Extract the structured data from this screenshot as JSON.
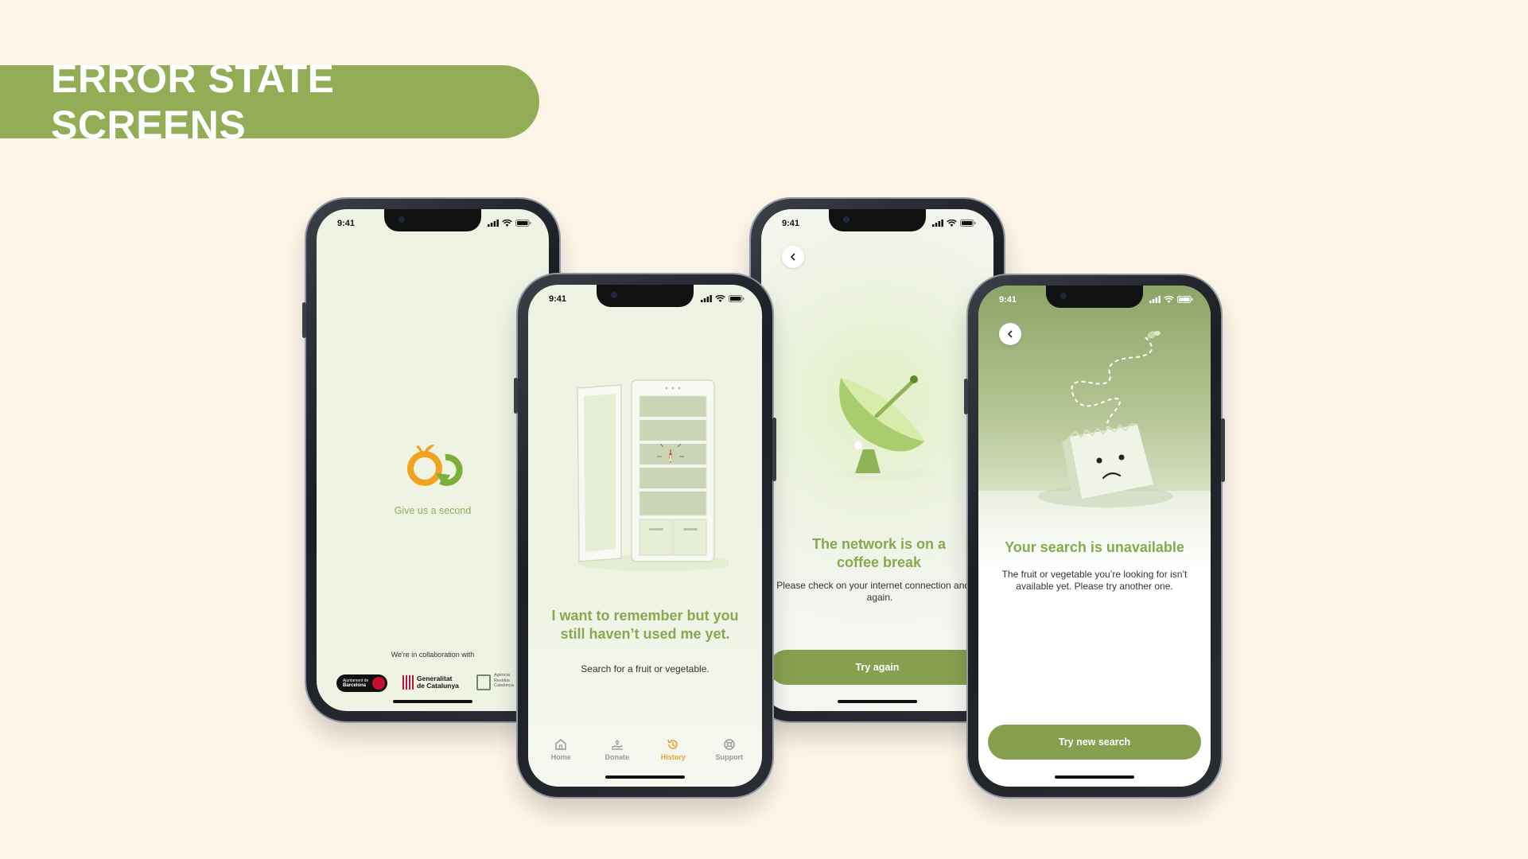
{
  "banner": {
    "title": "ERROR STATE SCREENS"
  },
  "colors": {
    "background": "#fdf5e8",
    "brand_green": "#93ad57",
    "accent_orange": "#e8a12a"
  },
  "status": {
    "time": "9:41"
  },
  "screen_loading": {
    "message": "Give us a second",
    "collab_label": "We're in collaboration with",
    "partners": [
      {
        "name": "Ajuntament de Barcelona",
        "line1": "Ajuntament de",
        "line2": "Barcelona"
      },
      {
        "name": "Generalitat de Catalunya",
        "line1": "Generalitat",
        "line2": "de Catalunya"
      },
      {
        "name": "Agència de Residus de Catalunya",
        "line1": "Agència",
        "line2": "Residus",
        "line3": "Catalunya"
      }
    ]
  },
  "screen_history_empty": {
    "title": "I want to remember but you still haven’t used me yet.",
    "subtitle": "Search for a fruit or vegetable.",
    "tabs": [
      {
        "label": "Home",
        "icon": "home-icon"
      },
      {
        "label": "Donate",
        "icon": "donate-icon"
      },
      {
        "label": "History",
        "icon": "history-icon",
        "active": true
      },
      {
        "label": "Support",
        "icon": "support-icon"
      }
    ]
  },
  "screen_network_error": {
    "title": "The network is on a coffee break",
    "body": "Please check on your internet connection and try again.",
    "button": "Try again"
  },
  "screen_search_unavailable": {
    "title": "Your search is unavailable",
    "body": "The fruit or vegetable you’re looking for isn’t available yet. Please try another one.",
    "button": "Try new search"
  }
}
